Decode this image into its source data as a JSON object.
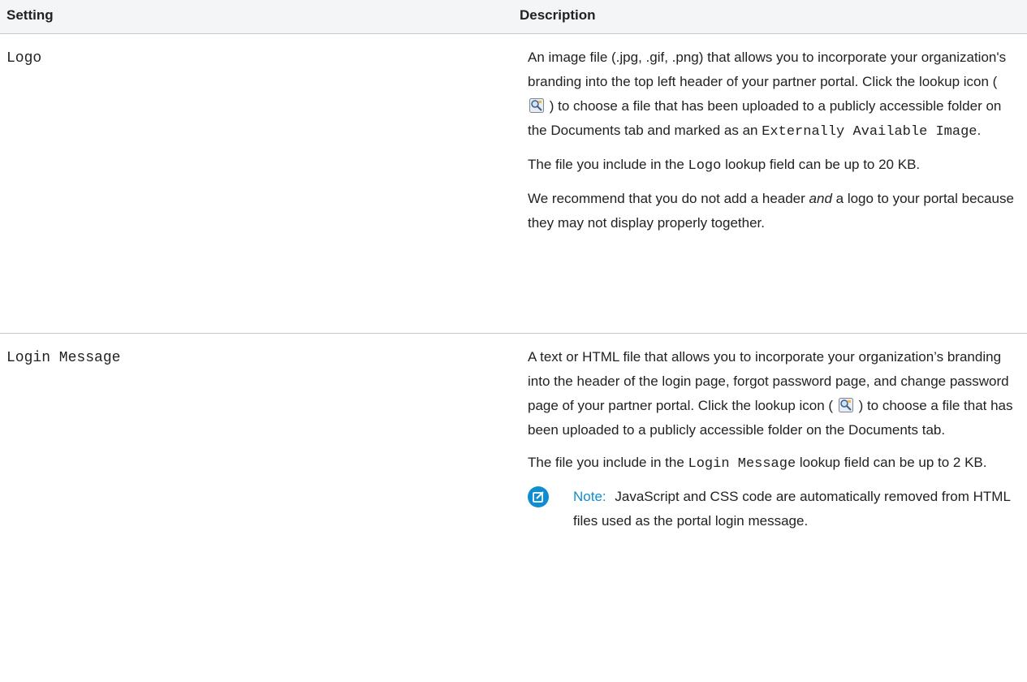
{
  "columns": {
    "setting": "Setting",
    "description": "Description"
  },
  "rows": [
    {
      "setting": "Logo",
      "p1_a": "An image file (.jpg, .gif, .png) that allows you to incorporate your organization's branding into the top left header of your partner portal. Click the lookup icon (",
      "p1_b": ") to choose a file that has been uploaded to a publicly accessible folder on the Documents tab and marked as an",
      "p1_code": "Externally Available Image",
      "p1_c": ".",
      "p2_a": "The file you include in the",
      "p2_code": "Logo",
      "p2_b": "lookup field can be up to 20 KB.",
      "p3_a": "We recommend that you do not add a header",
      "p3_em": "and",
      "p3_b": "a logo to your portal because they may not display properly together."
    },
    {
      "setting": "Login Message",
      "p1_a": "A text or HTML file that allows you to incorporate your organization’s branding into the header of the login page, forgot password page, and change password page of your partner portal. Click the lookup icon (",
      "p1_b": ") to choose a file that has been uploaded to a publicly accessible folder on the Documents tab.",
      "p2_a": "The file you include in the",
      "p2_code": "Login Message",
      "p2_b": "lookup field can be up to 2 KB.",
      "note_label": "Note:",
      "note_text": "JavaScript and CSS code are automatically removed from HTML files used as the portal login message."
    }
  ],
  "colors": {
    "note_accent": "#0f8dd0",
    "divider": "#c9cacc",
    "header_bg": "#f4f5f6"
  },
  "icons": {
    "lookup": "lookup-icon",
    "note": "note-edit-icon"
  }
}
